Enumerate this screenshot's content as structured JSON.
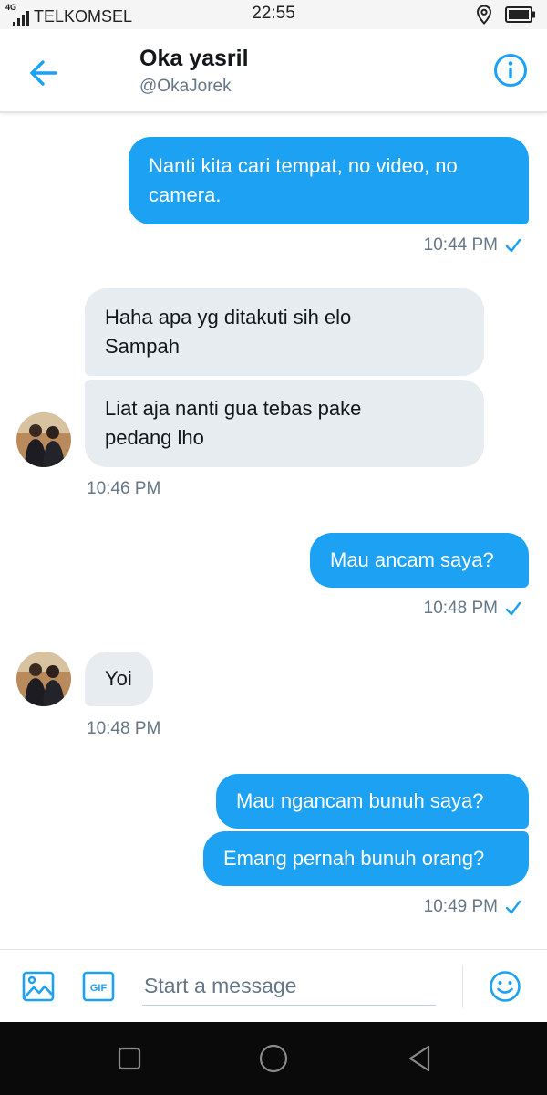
{
  "status_bar": {
    "network": "4G",
    "carrier": "TELKOMSEL",
    "time": "22:55",
    "icons": [
      "signal-icon",
      "location-icon",
      "battery-icon"
    ]
  },
  "header": {
    "back_icon": "arrow-left-icon",
    "name": "Oka yasril",
    "handle": "@OkaJorek",
    "info_icon": "info-icon"
  },
  "messages": [
    {
      "direction": "out",
      "lines": [
        "Nanti kita cari tempat, no video, no",
        "camera."
      ]
    },
    {
      "direction": "out",
      "time": "10:44 PM",
      "status": "check-icon"
    },
    {
      "direction": "in",
      "lines": [
        "Haha apa yg ditakuti sih elo",
        "Sampah"
      ]
    },
    {
      "direction": "in",
      "lines": [
        "Liat aja nanti gua tebas pake",
        "pedang lho"
      ]
    },
    {
      "direction": "in",
      "time": "10:46 PM"
    },
    {
      "direction": "out",
      "lines": [
        "Mau ancam saya?"
      ]
    },
    {
      "direction": "out",
      "time": "10:48 PM",
      "status": "check-icon"
    },
    {
      "direction": "in",
      "lines": [
        "Yoi"
      ]
    },
    {
      "direction": "in",
      "time": "10:48 PM"
    },
    {
      "direction": "out",
      "lines": [
        "Mau ngancam bunuh saya?"
      ]
    },
    {
      "direction": "out",
      "lines": [
        "Emang pernah bunuh orang?"
      ]
    },
    {
      "direction": "out",
      "time": "10:49 PM",
      "status": "check-icon"
    }
  ],
  "compose": {
    "placeholder": "Start a message",
    "value": "",
    "gif_label": "GIF",
    "image_icon": "image-icon",
    "emoji_icon": "emoji-icon"
  },
  "colors": {
    "accent": "#1da1f2",
    "incoming_bubble": "#e6ecf0",
    "secondary_text": "#657786"
  }
}
